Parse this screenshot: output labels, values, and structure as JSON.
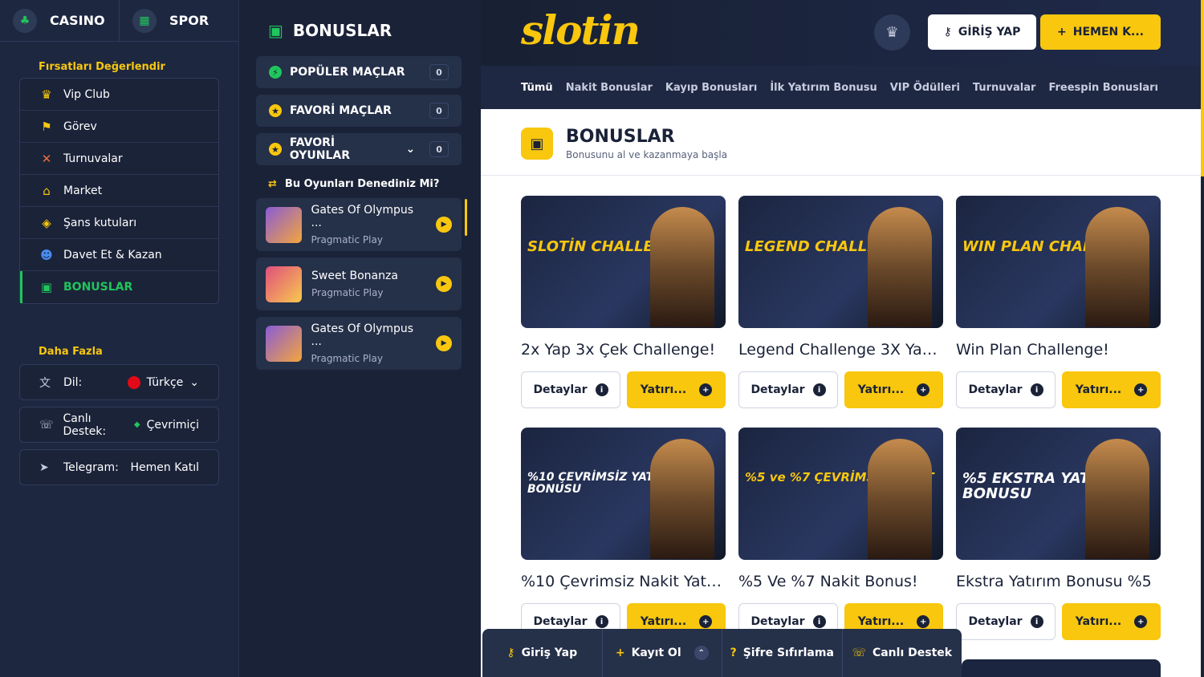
{
  "topnav": {
    "casino": "CASINO",
    "spor": "SPOR"
  },
  "sidebar": {
    "section1_title": "Fırsatları Değerlendir",
    "items": [
      {
        "label": "Vip Club",
        "icon": "crown-icon"
      },
      {
        "label": "Görev",
        "icon": "flag-icon"
      },
      {
        "label": "Turnuvalar",
        "icon": "swords-icon"
      },
      {
        "label": "Market",
        "icon": "store-icon"
      },
      {
        "label": "Şans kutuları",
        "icon": "box-icon"
      },
      {
        "label": "Davet Et & Kazan",
        "icon": "users-icon"
      },
      {
        "label": "BONUSLAR",
        "icon": "gift-icon"
      }
    ],
    "section2_title": "Daha Fazla",
    "dil_label": "Dil:",
    "dil_value": "Türkçe",
    "support_label": "Canlı Destek:",
    "support_value": "Çevrimiçi",
    "telegram_label": "Telegram:",
    "telegram_value": "Hemen Katıl"
  },
  "panel": {
    "title": "BONUSLAR",
    "pills": [
      {
        "label": "POPÜLER MAÇLAR",
        "count": "0"
      },
      {
        "label": "FAVORİ MAÇLAR",
        "count": "0"
      },
      {
        "label": "FAVORİ OYUNLAR",
        "count": "0"
      }
    ],
    "tried_label": "Bu Oyunları Denediniz Mi?",
    "games": [
      {
        "title": "Gates Of Olympus ...",
        "provider": "Pragmatic Play"
      },
      {
        "title": "Sweet Bonanza",
        "provider": "Pragmatic Play"
      },
      {
        "title": "Gates Of Olympus ...",
        "provider": "Pragmatic Play"
      }
    ]
  },
  "header": {
    "logo_a": "slot",
    "logo_b": "in",
    "login": "GİRİŞ YAP",
    "register": "HEMEN K..."
  },
  "tabs": [
    "Tümü",
    "Nakit Bonuslar",
    "Kayıp Bonusları",
    "İlk Yatırım Bonusu",
    "VIP Ödülleri",
    "Turnuvalar",
    "Freespin Bonusları"
  ],
  "page": {
    "title": "BONUSLAR",
    "subtitle": "Bonusunu al ve kazanmaya başla"
  },
  "bonuses": [
    {
      "name": "2x Yap 3x Çek Challenge!",
      "banner": "SLOTİN CHALLENGE",
      "details": "Detaylar",
      "deposit": "Yatırı..."
    },
    {
      "name": "Legend Challenge 3X Yap ...",
      "banner": "LEGEND CHALLENGE",
      "details": "Detaylar",
      "deposit": "Yatırı..."
    },
    {
      "name": "Win Plan Challenge!",
      "banner": "WIN PLAN CHALLENGE",
      "details": "Detaylar",
      "deposit": "Yatırı..."
    },
    {
      "name": "%10 Çevrimsiz Nakit Yatırı...",
      "banner": "%10 ÇEVRİMSİZ YATIRIM BONUSU",
      "details": "Detaylar",
      "deposit": "Yatırı..."
    },
    {
      "name": "%5 Ve %7 Nakit Bonus!",
      "banner": "%5 ve %7 ÇEVRİMSİZ NAKİT",
      "details": "Detaylar",
      "deposit": "Yatırı..."
    },
    {
      "name": "Ekstra Yatırım Bonusu %5",
      "banner": "%5 EKSTRA YATIRIM BONUSU",
      "details": "Detaylar",
      "deposit": "Yatırı..."
    }
  ],
  "bottombar": {
    "login": "Giriş Yap",
    "register": "Kayıt Ol",
    "reset": "Şifre Sıfırlama",
    "support": "Canlı Destek"
  },
  "colors": {
    "accent": "#f8c70e",
    "active": "#20c55b",
    "bg": "#1a2136"
  }
}
